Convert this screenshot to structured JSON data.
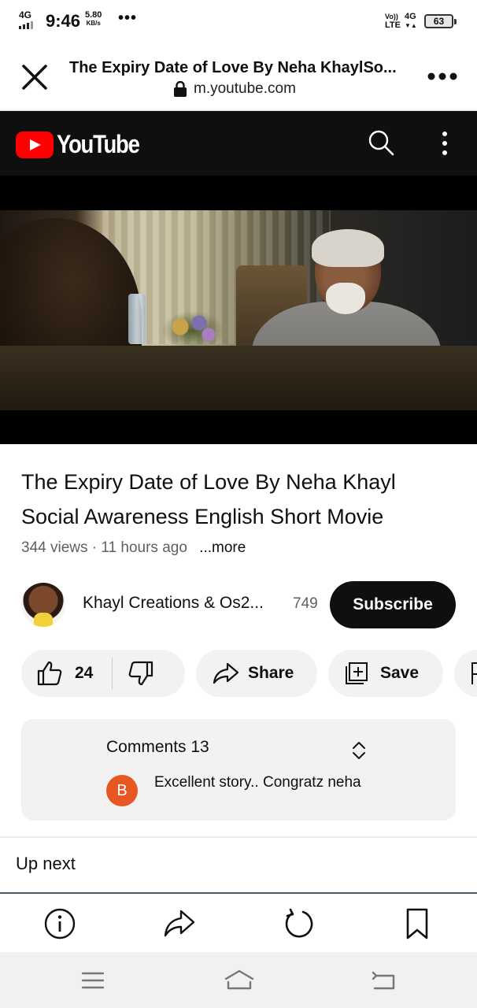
{
  "status_bar": {
    "network": "4G",
    "time": "9:46",
    "speed_value": "5.80",
    "speed_unit": "KB/s",
    "overflow": "•••",
    "volte": "Vo))",
    "volte_sub": "LTE",
    "network_right": "4G",
    "battery": "63"
  },
  "browser": {
    "page_title": "The Expiry Date of Love By Neha KhaylSo...",
    "url": "m.youtube.com"
  },
  "youtube": {
    "logo_text": "YouTube"
  },
  "video": {
    "title": "The Expiry Date of Love By Neha Khayl Social Awareness English Short Movie",
    "views": "344 views",
    "separator": "·",
    "age": "11 hours ago",
    "more": "...more"
  },
  "channel": {
    "name": "Khayl Creations & Os2...",
    "subscribers": "749",
    "subscribe_label": "Subscribe"
  },
  "actions": {
    "like_count": "24",
    "share_label": "Share",
    "save_label": "Save"
  },
  "comments": {
    "title": "Comments 13",
    "top_comment_avatar": "B",
    "top_comment_text": "Excellent story.. Congratz neha",
    "avatar_color": "#e65722"
  },
  "up_next": {
    "label": "Up next"
  },
  "colors": {
    "youtube_red": "#ff0000",
    "header_bg": "#0f0f0f",
    "pill_bg": "#f2f2f2"
  }
}
